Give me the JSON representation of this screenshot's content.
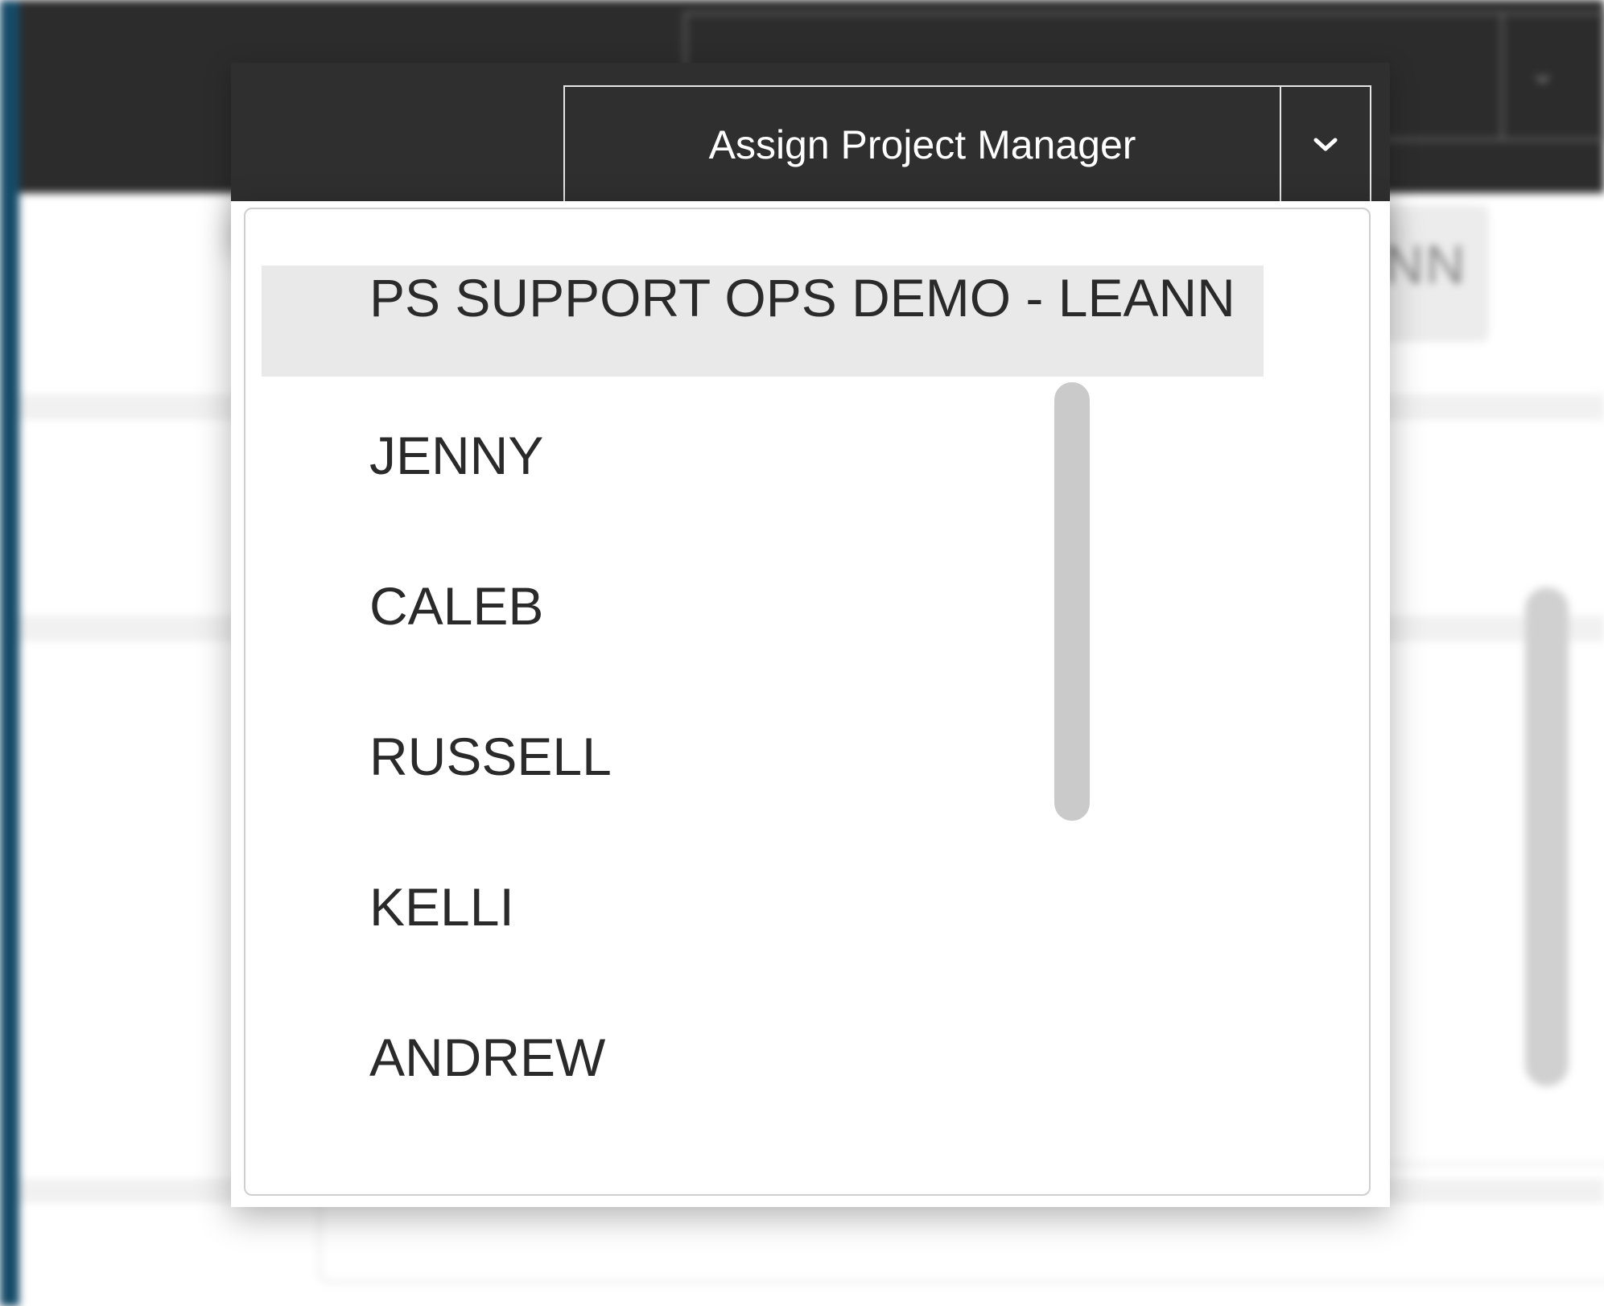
{
  "background": {
    "chip_text": "NN"
  },
  "project_manager_select": {
    "label": "Assign Project Manager",
    "toggle_icon": "chevron-down-icon"
  },
  "dropdown": {
    "selected_index": 0,
    "items": [
      {
        "label": "PS SUPPORT OPS DEMO - LEANN"
      },
      {
        "label": "JENNY"
      },
      {
        "label": "CALEB"
      },
      {
        "label": "RUSSELL"
      },
      {
        "label": "KELLI"
      },
      {
        "label": "ANDREW"
      }
    ]
  },
  "colors": {
    "header_bg": "#2f2f2f",
    "sidebar_accent": "#154b68",
    "selected_item_bg": "#e9e9e9",
    "scrollbar": "#cacaca"
  }
}
